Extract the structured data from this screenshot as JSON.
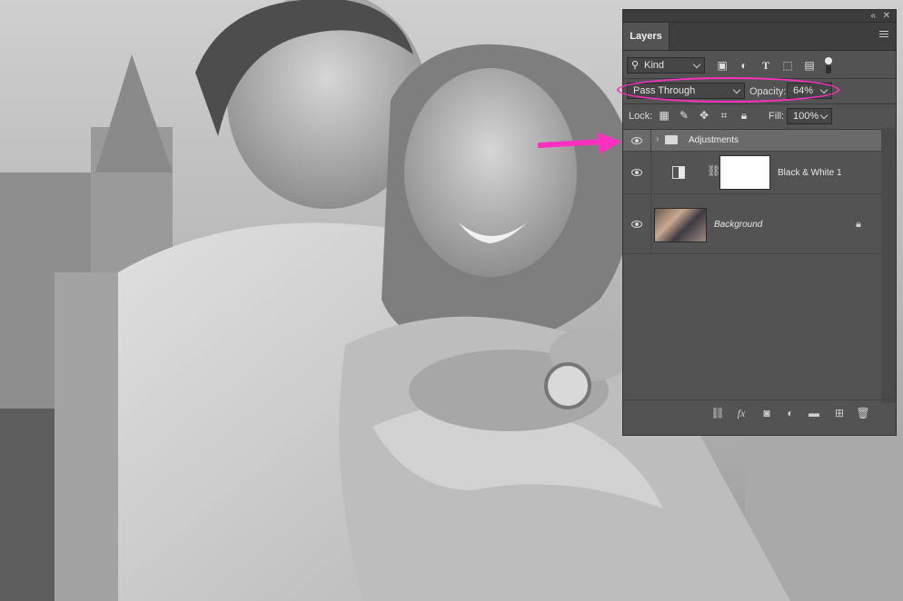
{
  "panel": {
    "tab_label": "Layers",
    "top_controls": [
      "«",
      "✕"
    ],
    "filter": {
      "kind_label": "Kind"
    },
    "blend_mode": "Pass Through",
    "opacity_label": "Opacity:",
    "opacity_value": "64%",
    "lock_label": "Lock:",
    "fill_label": "Fill:",
    "fill_value": "100%"
  },
  "layers": [
    {
      "name": "Adjustments",
      "type": "group",
      "visible": true,
      "selected": true
    },
    {
      "name": "Black & White 1",
      "type": "adjustment",
      "visible": true
    },
    {
      "name": "Background",
      "type": "pixel",
      "visible": true,
      "locked": true
    }
  ],
  "annotations": {
    "highlight_color": "#ff2fc0"
  }
}
